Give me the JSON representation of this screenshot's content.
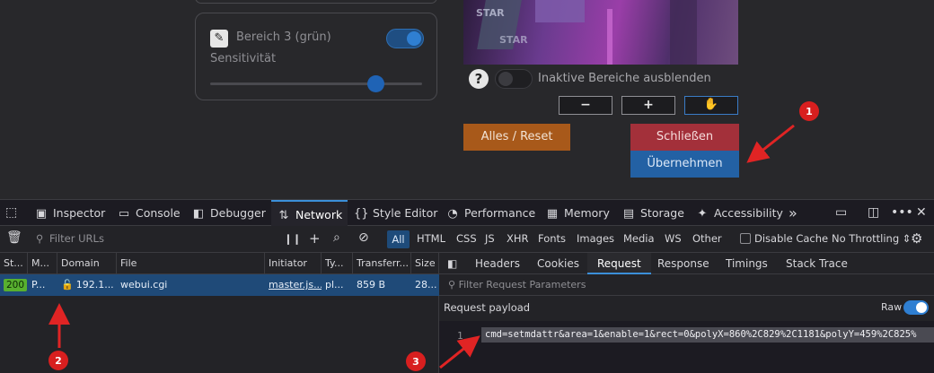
{
  "app": {
    "region_title": "Bereich 3 (grün)",
    "sensitivity_label": "Sensitivität",
    "sensitivity_value": 0.78,
    "region_enabled": true,
    "hide_inactive_label": "Inaktive Bereiche ausblenden",
    "hide_inactive_enabled": false,
    "help_glyph": "?",
    "zoom_out_label": "−",
    "zoom_in_label": "+",
    "pan_glyph": "✋",
    "reset_label": "Alles / Reset",
    "close_label": "Schließen",
    "apply_label": "Übernehmen",
    "camera_text_1": "STAR",
    "camera_text_2": "STAR",
    "colors": {
      "reset": "#a8591a",
      "close": "#a3303a",
      "apply": "#2361a4"
    }
  },
  "devtools": {
    "tabs": [
      {
        "label": "Inspector",
        "icon": "inspector-icon"
      },
      {
        "label": "Console",
        "icon": "console-icon"
      },
      {
        "label": "Debugger",
        "icon": "debugger-icon"
      },
      {
        "label": "Network",
        "icon": "network-icon"
      },
      {
        "label": "Style Editor",
        "icon": "style-editor-icon"
      },
      {
        "label": "Performance",
        "icon": "performance-icon"
      },
      {
        "label": "Memory",
        "icon": "memory-icon"
      },
      {
        "label": "Storage",
        "icon": "storage-icon"
      },
      {
        "label": "Accessibility",
        "icon": "accessibility-icon"
      }
    ],
    "active_tab": "Network",
    "filter_placeholder": "Filter URLs",
    "type_filters": [
      "All",
      "HTML",
      "CSS",
      "JS",
      "XHR",
      "Fonts",
      "Images",
      "Media",
      "WS",
      "Other"
    ],
    "disable_cache_label": "Disable Cache",
    "throttling_label": "No Throttling ⇕",
    "columns": [
      "St...",
      "M...",
      "Domain",
      "File",
      "Initiator",
      "Ty...",
      "Transferr...",
      "Size"
    ],
    "request_row": {
      "status": "200",
      "method": "P...",
      "domain": "192.1...",
      "file": "webui.cgi",
      "initiator": "master.js...",
      "type": "pl...",
      "transferred": "859 B",
      "size": "28..."
    },
    "detail_tabs": [
      "Headers",
      "Cookies",
      "Request",
      "Response",
      "Timings",
      "Stack Trace"
    ],
    "active_detail_tab": "Request",
    "params_filter_placeholder": "Filter Request Parameters",
    "payload_title": "Request payload",
    "raw_label": "Raw",
    "raw_enabled": true,
    "payload_line_number": "1",
    "payload_text": "cmd=setmdattr&area=1&enable=1&rect=0&polyX=860%2C829%2C1181&polyY=459%2C825%"
  },
  "annotations": {
    "labels": [
      "1",
      "2",
      "3"
    ],
    "color": "#e02424"
  }
}
